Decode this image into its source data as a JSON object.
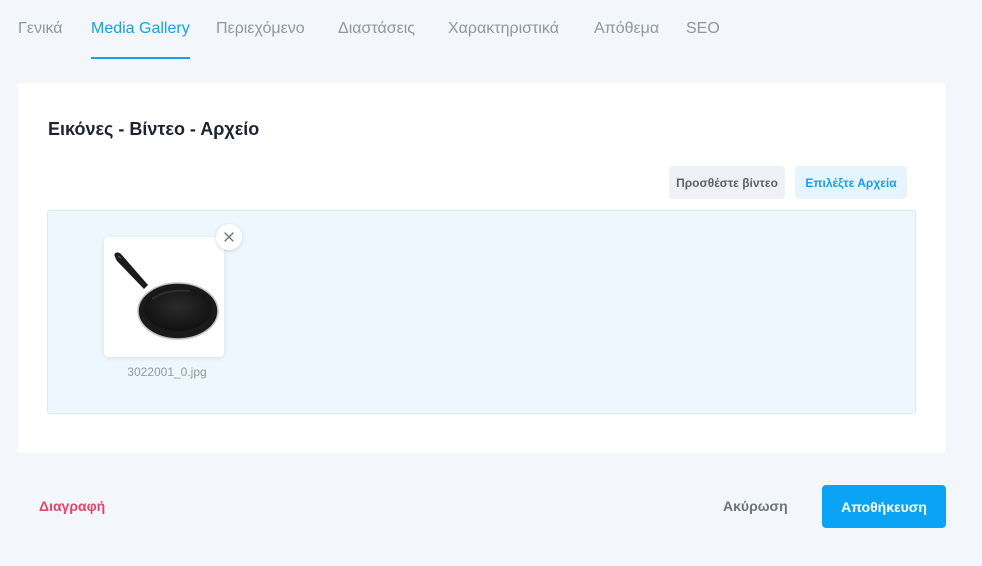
{
  "tabs": [
    {
      "label": "Γενικά"
    },
    {
      "label": "Media Gallery"
    },
    {
      "label": "Περιεχόμενο"
    },
    {
      "label": "Διαστάσεις"
    },
    {
      "label": "Χαρακτηριστικά"
    },
    {
      "label": "Απόθεμα"
    },
    {
      "label": "SEO"
    }
  ],
  "active_tab": "Media Gallery",
  "media": {
    "title": "Εικόνες - Βίντεο - Αρχείο",
    "add_video_label": "Προσθέστε βίντεο",
    "choose_files_label": "Επιλέξτε Αρχεία",
    "files": [
      {
        "name": "3022001_0.jpg",
        "thumbnail_icon": "frying-pan-image"
      }
    ]
  },
  "footer": {
    "delete_label": "Διαγραφή",
    "cancel_label": "Ακύρωση",
    "save_label": "Αποθήκευση"
  },
  "colors": {
    "accent": "#1a9ee6",
    "primary_button": "#0ba4f5",
    "danger": "#e0466a",
    "background": "#f3f6fa"
  }
}
